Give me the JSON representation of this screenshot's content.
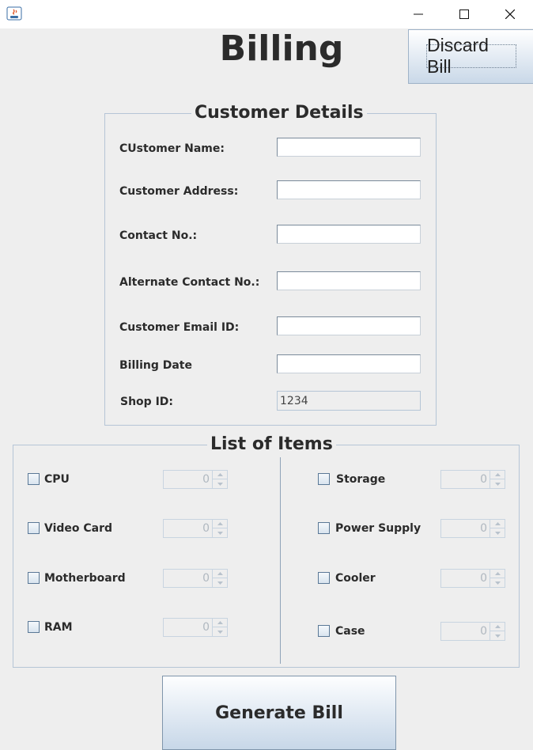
{
  "window": {
    "minimize_icon": "minimize-icon",
    "maximize_icon": "maximize-icon",
    "close_icon": "close-icon"
  },
  "header": {
    "title": "Billing",
    "discard_label": "Discard Bill"
  },
  "customer_details": {
    "title": "Customer Details",
    "fields": {
      "name": {
        "label": "CUstomer Name:",
        "value": ""
      },
      "address": {
        "label": "Customer Address:",
        "value": ""
      },
      "contact": {
        "label": "Contact No.:",
        "value": ""
      },
      "alt_contact": {
        "label": "Alternate Contact No.:",
        "value": ""
      },
      "email": {
        "label": "Customer Email ID:",
        "value": ""
      },
      "billing_date": {
        "label": "Billing Date",
        "value": ""
      },
      "shop_id": {
        "label": "Shop ID:",
        "value": "1234"
      }
    }
  },
  "items": {
    "title": "List of Items",
    "cpu": {
      "label": "CPU",
      "qty": "0",
      "checked": false
    },
    "video_card": {
      "label": "Video Card",
      "qty": "0",
      "checked": false
    },
    "motherboard": {
      "label": "Motherboard",
      "qty": "0",
      "checked": false
    },
    "ram": {
      "label": "RAM",
      "qty": "0",
      "checked": false
    },
    "storage": {
      "label": "Storage",
      "qty": "0",
      "checked": false
    },
    "power_supply": {
      "label": "Power Supply",
      "qty": "0",
      "checked": false
    },
    "cooler": {
      "label": "Cooler",
      "qty": "0",
      "checked": false
    },
    "case": {
      "label": "Case",
      "qty": "0",
      "checked": false
    }
  },
  "footer": {
    "generate_label": "Generate Bill"
  },
  "colors": {
    "window_bg": "#eeeeee",
    "border": "#b5c5d6",
    "button_gradient_bottom": "#c7d7e8"
  }
}
